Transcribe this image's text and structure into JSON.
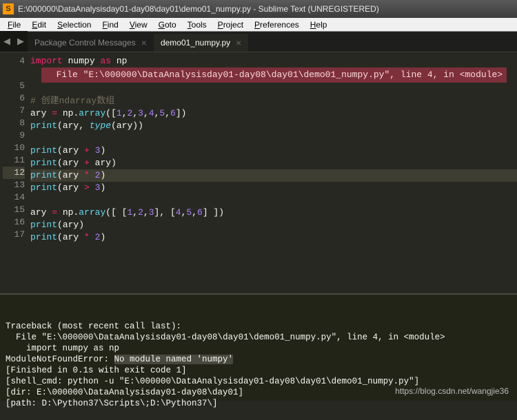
{
  "title_bar": {
    "icon_letter": "S",
    "text": "E:\\000000\\DataAnalysisday01-day08\\day01\\demo01_numpy.py - Sublime Text (UNREGISTERED)"
  },
  "menu": [
    "File",
    "Edit",
    "Selection",
    "Find",
    "View",
    "Goto",
    "Tools",
    "Project",
    "Preferences",
    "Help"
  ],
  "tabs": {
    "arrows": {
      "left": "◀",
      "right": "▶"
    },
    "items": [
      {
        "label": "Package Control Messages",
        "active": false
      },
      {
        "label": "demo01_numpy.py",
        "active": true
      }
    ],
    "close_glyph": "×"
  },
  "editor": {
    "inline_error": "  File \"E:\\000000\\DataAnalysisday01-day08\\day01\\demo01_numpy.py\", line 4, in <module>",
    "current_line": 12,
    "lines": [
      {
        "n": 4,
        "tokens": [
          [
            "kw",
            "import"
          ],
          [
            "var",
            " numpy "
          ],
          [
            "kw",
            "as"
          ],
          [
            "var",
            " np"
          ]
        ]
      },
      {
        "n": 5,
        "tokens": []
      },
      {
        "n": 6,
        "tokens": [
          [
            "cmt",
            "# 创建ndarray数组"
          ]
        ]
      },
      {
        "n": 7,
        "tokens": [
          [
            "var",
            "ary "
          ],
          [
            "op",
            "="
          ],
          [
            "var",
            " np"
          ],
          [
            "pn",
            "."
          ],
          [
            "fn",
            "array"
          ],
          [
            "pn",
            "(["
          ],
          [
            "num",
            "1"
          ],
          [
            "pn",
            ","
          ],
          [
            "num",
            "2"
          ],
          [
            "pn",
            ","
          ],
          [
            "num",
            "3"
          ],
          [
            "pn",
            ","
          ],
          [
            "num",
            "4"
          ],
          [
            "pn",
            ","
          ],
          [
            "num",
            "5"
          ],
          [
            "pn",
            ","
          ],
          [
            "num",
            "6"
          ],
          [
            "pn",
            "])"
          ]
        ]
      },
      {
        "n": 8,
        "tokens": [
          [
            "fn",
            "print"
          ],
          [
            "pn",
            "("
          ],
          [
            "var",
            "ary"
          ],
          [
            "pn",
            ", "
          ],
          [
            "kw2",
            "type"
          ],
          [
            "pn",
            "("
          ],
          [
            "var",
            "ary"
          ],
          [
            "pn",
            "))"
          ]
        ]
      },
      {
        "n": 9,
        "tokens": []
      },
      {
        "n": 10,
        "tokens": [
          [
            "fn",
            "print"
          ],
          [
            "pn",
            "("
          ],
          [
            "var",
            "ary "
          ],
          [
            "op",
            "+"
          ],
          [
            "var",
            " "
          ],
          [
            "num",
            "3"
          ],
          [
            "pn",
            ")"
          ]
        ]
      },
      {
        "n": 11,
        "tokens": [
          [
            "fn",
            "print"
          ],
          [
            "pn",
            "("
          ],
          [
            "var",
            "ary "
          ],
          [
            "op",
            "+"
          ],
          [
            "var",
            " ary"
          ],
          [
            "pn",
            ")"
          ]
        ]
      },
      {
        "n": 12,
        "tokens": [
          [
            "fn",
            "print"
          ],
          [
            "pn",
            "("
          ],
          [
            "var",
            "ary "
          ],
          [
            "op",
            "*"
          ],
          [
            "var",
            " "
          ],
          [
            "num",
            "2"
          ],
          [
            "pn",
            ")"
          ]
        ]
      },
      {
        "n": 13,
        "tokens": [
          [
            "fn",
            "print"
          ],
          [
            "pn",
            "("
          ],
          [
            "var",
            "ary "
          ],
          [
            "op",
            ">"
          ],
          [
            "var",
            " "
          ],
          [
            "num",
            "3"
          ],
          [
            "pn",
            ")"
          ]
        ]
      },
      {
        "n": 14,
        "tokens": []
      },
      {
        "n": 15,
        "tokens": [
          [
            "var",
            "ary "
          ],
          [
            "op",
            "="
          ],
          [
            "var",
            " np"
          ],
          [
            "pn",
            "."
          ],
          [
            "fn",
            "array"
          ],
          [
            "pn",
            "([ ["
          ],
          [
            "num",
            "1"
          ],
          [
            "pn",
            ","
          ],
          [
            "num",
            "2"
          ],
          [
            "pn",
            ","
          ],
          [
            "num",
            "3"
          ],
          [
            "pn",
            "], ["
          ],
          [
            "num",
            "4"
          ],
          [
            "pn",
            ","
          ],
          [
            "num",
            "5"
          ],
          [
            "pn",
            ","
          ],
          [
            "num",
            "6"
          ],
          [
            "pn",
            "] ])"
          ]
        ]
      },
      {
        "n": 16,
        "tokens": [
          [
            "fn",
            "print"
          ],
          [
            "pn",
            "("
          ],
          [
            "var",
            "ary"
          ],
          [
            "pn",
            ")"
          ]
        ]
      },
      {
        "n": 17,
        "tokens": [
          [
            "fn",
            "print"
          ],
          [
            "pn",
            "("
          ],
          [
            "var",
            "ary "
          ],
          [
            "op",
            "*"
          ],
          [
            "var",
            " "
          ],
          [
            "num",
            "2"
          ],
          [
            "pn",
            ")"
          ]
        ]
      }
    ]
  },
  "console": {
    "lines": [
      "Traceback (most recent call last):",
      "  File \"E:\\000000\\DataAnalysisday01-day08\\day01\\demo01_numpy.py\", line 4, in <module>",
      "    import numpy as np",
      {
        "before": "ModuleNotFoundError: ",
        "sel": "No module named 'numpy'"
      },
      "[Finished in 0.1s with exit code 1]",
      "[shell_cmd: python -u \"E:\\000000\\DataAnalysisday01-day08\\day01\\demo01_numpy.py\"]",
      "[dir: E:\\000000\\DataAnalysisday01-day08\\day01]",
      "[path: D:\\Python37\\Scripts\\;D:\\Python37\\]"
    ]
  },
  "watermark": "https://blog.csdn.net/wangjie36"
}
